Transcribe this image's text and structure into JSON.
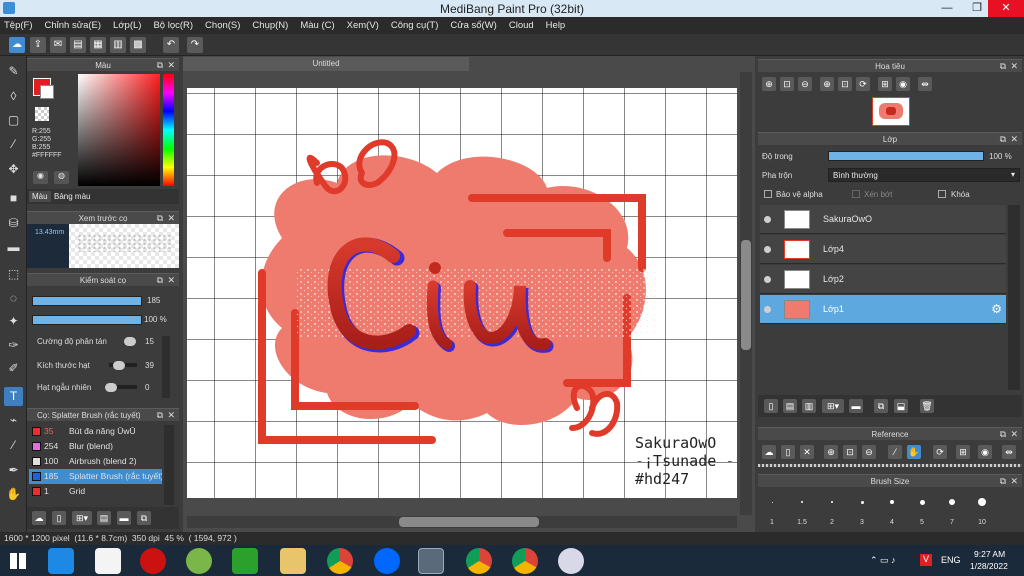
{
  "window": {
    "title": "MediBang Paint Pro (32bit)"
  },
  "menu": [
    "Tệp(F)",
    "Chỉnh sửa(E)",
    "Lớp(L)",
    "Bộ lọc(R)",
    "Chọn(S)",
    "Chụp(N)",
    "Màu (C)",
    "Xem(V)",
    "Công cụ(T)",
    "Cửa sổ(W)",
    "Cloud",
    "Help"
  ],
  "color_panel": {
    "title": "Màu",
    "rgb": [
      "R:255",
      "G:255",
      "B:255"
    ],
    "hex": "#FFFFFF",
    "tabs": [
      "Màu",
      "Bảng màu"
    ]
  },
  "brush_preview": {
    "title": "Xem trước cọ",
    "size": "13.43mm"
  },
  "brush_control": {
    "title": "Kiểm soát cọ",
    "size_value": "185",
    "opacity_value": "100 %",
    "scatter_label": "Cường độ phân tán",
    "scatter_value": "15",
    "grain_label": "Kích thước hạt",
    "grain_value": "39",
    "random_label": "Hạt ngẫu nhiên",
    "random_value": "0"
  },
  "brush_list": {
    "title": "Cọ: Splatter Brush (rắc tuyết)",
    "items": [
      {
        "num": "35",
        "name": "Bút đa năng ŪwŪ",
        "color": "#e83030"
      },
      {
        "num": "254",
        "name": "Blur (blend)",
        "color": "#e070e0"
      },
      {
        "num": "100",
        "name": "Airbrush (blend 2)",
        "color": "#e0e0e0"
      },
      {
        "num": "185",
        "name": "Splatter Brush (rắc tuyết)",
        "color": "#2060e0"
      },
      {
        "num": "1",
        "name": "Grid",
        "color": "#e83030"
      }
    ]
  },
  "canvas": {
    "tab": "Untitled",
    "signature": [
      "SakuraOwO",
      "-¡Tsunade -",
      "#hd247"
    ]
  },
  "status": {
    "text": "1600 * 1200 pixel  (11.6 * 8.7cm)  350 dpi  45 %  ( 1594, 972 )"
  },
  "navigator": {
    "title": "Hoa tiêu"
  },
  "layer_panel": {
    "title": "Lớp",
    "opacity_label": "Độ trong",
    "opacity_value": "100 %",
    "opacity_level": 1.0,
    "blend_label": "Pha trộn",
    "blend_value": "Bình thường",
    "protect_alpha": "Bảo vệ alpha",
    "clipping": "Xén bớt",
    "lock": "Khóa",
    "layers": [
      "SakuraOwO",
      "Lớp4",
      "Lớp2",
      "Lớp1"
    ]
  },
  "reference": {
    "title": "Reference"
  },
  "brush_size": {
    "title": "Brush Size",
    "sizes": [
      "1",
      "1.5",
      "2",
      "3",
      "4",
      "5",
      "7",
      "10"
    ]
  },
  "taskbar": {
    "lang": "ENG",
    "time": "9:27 AM",
    "date": "1/28/2022"
  },
  "colors": {
    "accent": "#3f8dd0",
    "red": "#e03a2a",
    "pink": "#ef7a6e"
  }
}
